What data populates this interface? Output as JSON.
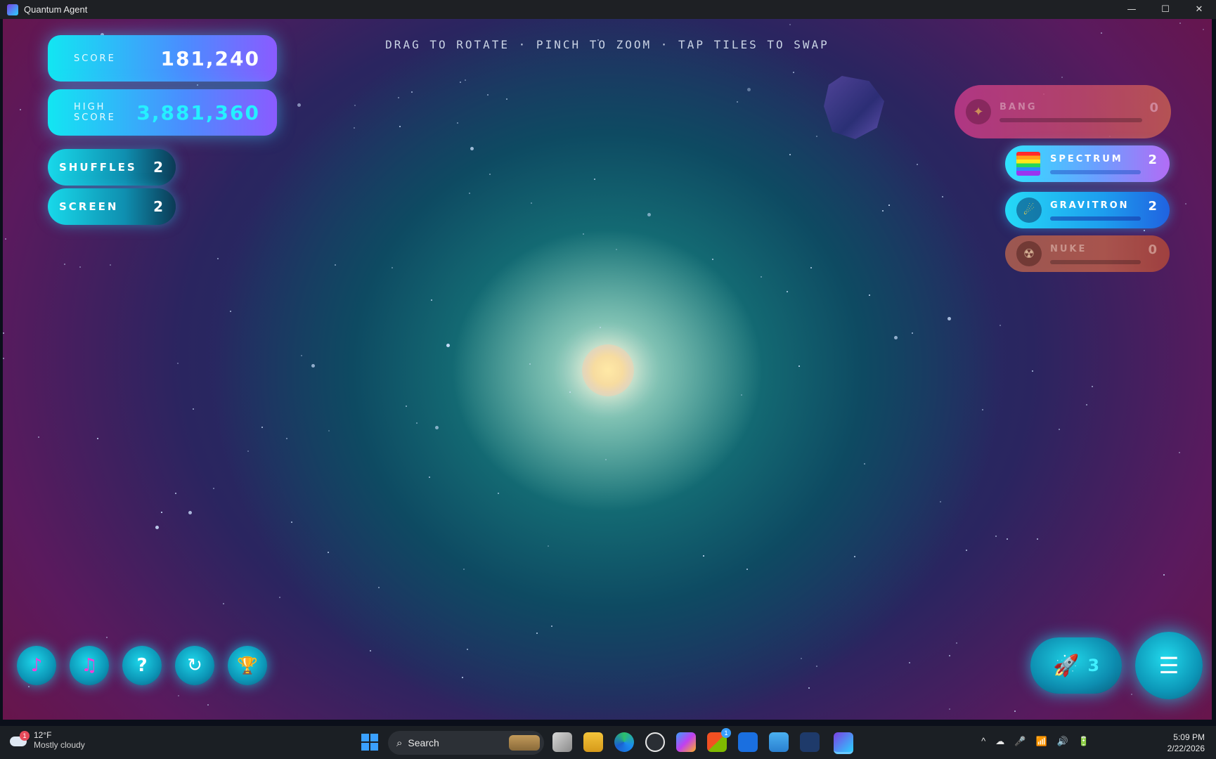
{
  "window": {
    "title": "Quantum Agent",
    "controls": [
      "—",
      "☐",
      "✕"
    ]
  },
  "hint": "DRAG TO ROTATE · PINCH TO ZOOM · TAP TILES TO SWAP",
  "score": {
    "label": "SCORE",
    "value": "181,240"
  },
  "high_score": {
    "label": "HIGH SCORE",
    "value": "3,881,360"
  },
  "counters": [
    {
      "label": "SHUFFLES",
      "value": "2"
    },
    {
      "label": "SCREEN",
      "value": "2"
    }
  ],
  "powerups": [
    {
      "id": "bang",
      "label": "BANG",
      "value": "0",
      "icon": "sparkle-icon",
      "glyph": "✦",
      "progress": 0.0
    },
    {
      "id": "spectrum",
      "label": "SPECTRUM",
      "value": "2",
      "icon": "rainbow-icon",
      "glyph": "",
      "progress": 0.0
    },
    {
      "id": "gravitron",
      "label": "GRAVITRON",
      "value": "2",
      "icon": "orbit-icon",
      "glyph": "☄",
      "progress": 0.0
    },
    {
      "id": "nuke",
      "label": "NUKE",
      "value": "0",
      "icon": "radiation-icon",
      "glyph": "☢",
      "progress": 0.0
    }
  ],
  "bottom_buttons": [
    {
      "name": "music-toggle-button",
      "icon": "music-note-icon",
      "glyph": "♪"
    },
    {
      "name": "sound-toggle-button",
      "icon": "double-note-icon",
      "glyph": "♫"
    },
    {
      "name": "help-button",
      "icon": "question-icon",
      "glyph": "?"
    },
    {
      "name": "restart-button",
      "icon": "restart-icon",
      "glyph": "↻"
    },
    {
      "name": "trophy-button",
      "icon": "trophy-icon",
      "glyph": "🏆"
    }
  ],
  "rocket": {
    "icon": "rocket-icon",
    "glyph": "🚀",
    "count": "3"
  },
  "menu": {
    "icon": "hamburger-menu-icon",
    "glyph": "☰"
  },
  "taskbar": {
    "weather": {
      "badge": "1",
      "temp": "12°F",
      "condition": "Mostly cloudy"
    },
    "search_label": "Search",
    "store_badge": "1",
    "time": "5:09 PM",
    "date": "2/22/2026",
    "tray": [
      "^",
      "☁",
      "🎤",
      "📶",
      "🔊",
      "🔋"
    ]
  },
  "colors": {
    "accent_cyan": "#18d9ea",
    "accent_purple": "#8a5bff",
    "high_score_text": "#25f0ff"
  }
}
